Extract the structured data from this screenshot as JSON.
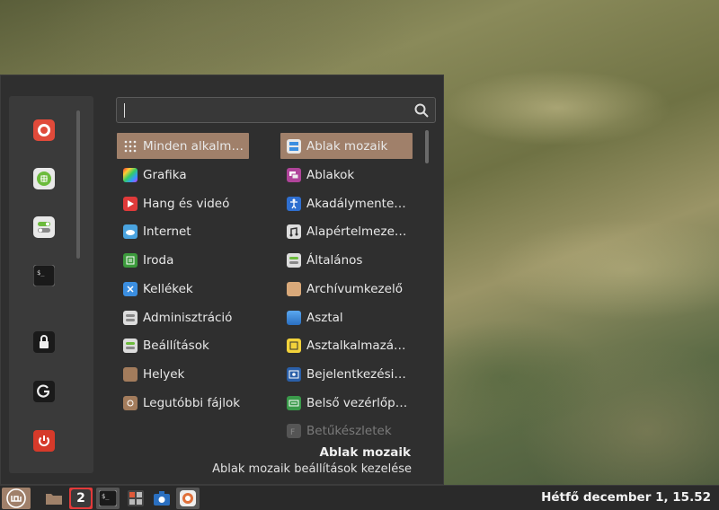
{
  "search": {
    "placeholder": "",
    "value": ""
  },
  "sidebar": {
    "items": [
      {
        "icon": "firefox-icon"
      },
      {
        "icon": "software-manager-icon"
      },
      {
        "icon": "settings-toggle-icon"
      },
      {
        "icon": "terminal-icon"
      },
      {
        "icon": "lock-icon"
      },
      {
        "icon": "logout-icon"
      },
      {
        "icon": "power-icon"
      }
    ]
  },
  "categories": [
    {
      "label": "Minden alkalm…",
      "icon": "grid-icon",
      "selected": true
    },
    {
      "label": "Grafika",
      "icon": "graphics-icon"
    },
    {
      "label": "Hang és videó",
      "icon": "multimedia-icon"
    },
    {
      "label": "Internet",
      "icon": "cloud-icon"
    },
    {
      "label": "Iroda",
      "icon": "office-icon"
    },
    {
      "label": "Kellékek",
      "icon": "accessories-icon"
    },
    {
      "label": "Adminisztráció",
      "icon": "admin-icon"
    },
    {
      "label": "Beállítások",
      "icon": "preferences-icon"
    },
    {
      "label": "Helyek",
      "icon": "folder-icon"
    },
    {
      "label": "Legutóbbi fájlok",
      "icon": "recent-folder-icon"
    }
  ],
  "apps": [
    {
      "label": "Ablak mozaik",
      "icon": "window-tile-icon",
      "selected": true
    },
    {
      "label": "Ablakok",
      "icon": "windows-icon"
    },
    {
      "label": "Akadálymente…",
      "icon": "accessibility-icon"
    },
    {
      "label": "Alapértelmeze…",
      "icon": "default-apps-icon"
    },
    {
      "label": "Általános",
      "icon": "general-icon"
    },
    {
      "label": "Archívumkezelő",
      "icon": "archive-icon"
    },
    {
      "label": "Asztal",
      "icon": "desktop-icon"
    },
    {
      "label": "Asztalkalmazá…",
      "icon": "desklets-icon"
    },
    {
      "label": "Bejelentkezési…",
      "icon": "login-icon"
    },
    {
      "label": "Belső vezérlőp…",
      "icon": "control-panel-icon"
    },
    {
      "label": "Betűkészletek",
      "icon": "fonts-icon",
      "dim": true
    }
  ],
  "description": {
    "title": "Ablak mozaik",
    "subtitle": "Ablak mozaik beállítások kezelése"
  },
  "panel": {
    "workspace_badge": "2",
    "clock": "Hétfő december 1, 15.52"
  },
  "colors": {
    "menu_bg": "#2f2f2f",
    "sidebar_bg": "#3a3a3a",
    "selected_bg": "#a0806a",
    "panel_bg": "#2a2a2a"
  }
}
